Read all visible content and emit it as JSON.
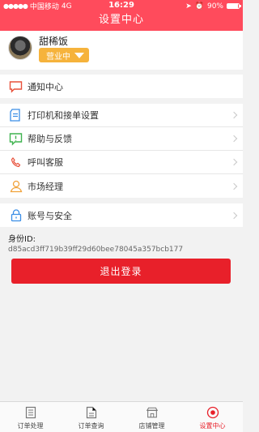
{
  "status_bar": {
    "carrier": "中国移动",
    "network": "4G",
    "time": "16:29",
    "battery_text": "90%",
    "battery_level": 0.9
  },
  "nav": {
    "title": "设置中心"
  },
  "profile": {
    "name": "甜稀饭",
    "status_label": "营业中"
  },
  "menu": {
    "notice": "通知中心",
    "printer": "打印机和接单设置",
    "help": "帮助与反馈",
    "call": "呼叫客服",
    "manager": "市场经理",
    "account": "账号与安全"
  },
  "identity": {
    "label": "身份ID:",
    "value": "d85acd3ff719b39ff29d60bee78045a357bcb177"
  },
  "logout_label": "退出登录",
  "tabs": [
    {
      "label": "订单处理",
      "icon": "order-doc-icon"
    },
    {
      "label": "订单查询",
      "icon": "order-search-icon"
    },
    {
      "label": "店铺管理",
      "icon": "shop-icon"
    },
    {
      "label": "设置中心",
      "icon": "settings-target-icon"
    }
  ],
  "colors": {
    "header": "#ff4b5c",
    "accent": "#e8202a",
    "status_badge": "#f6b33c"
  }
}
